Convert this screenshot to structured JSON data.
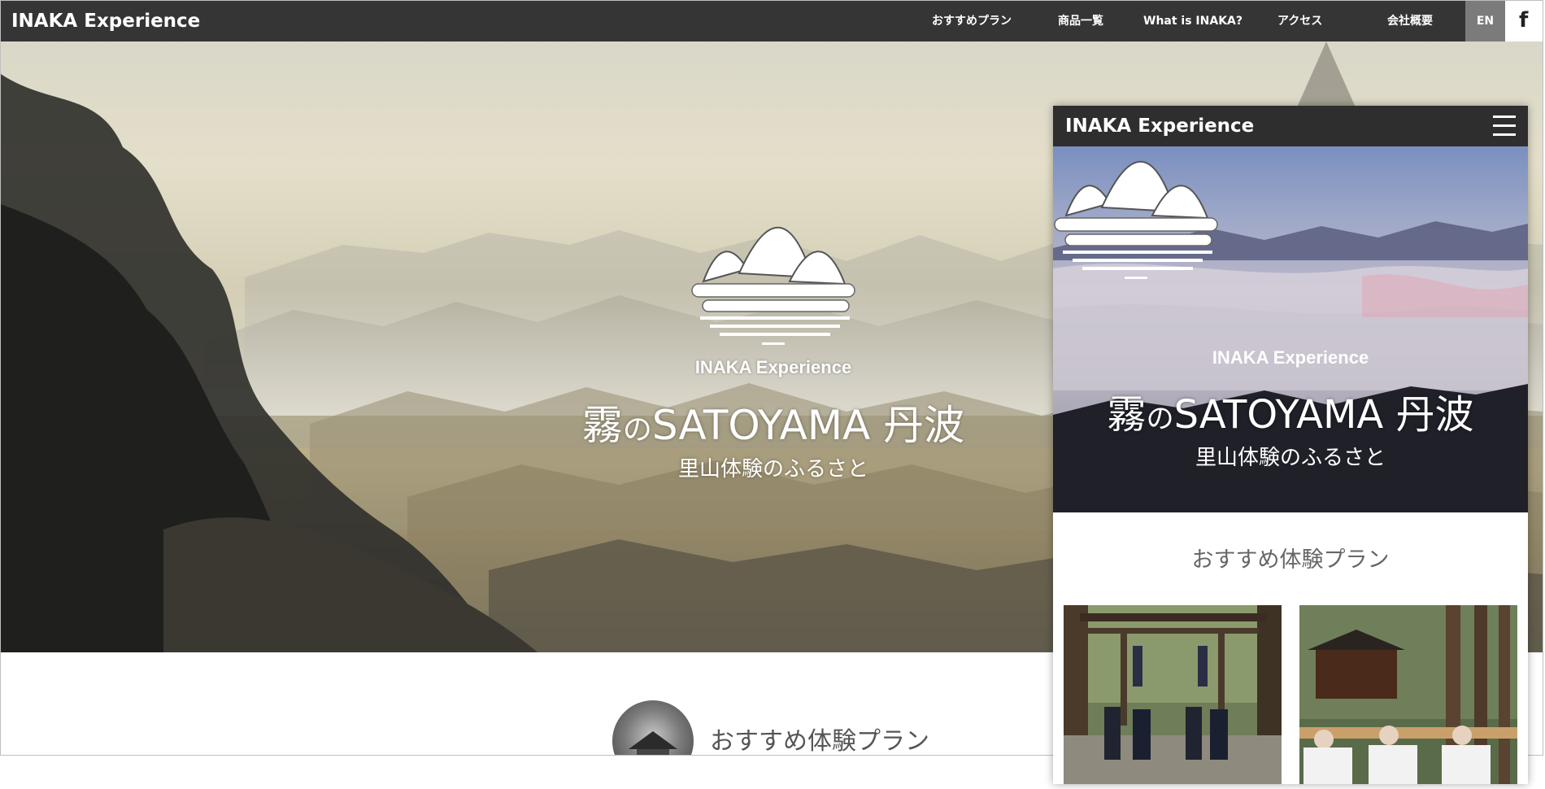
{
  "header": {
    "brand": "INAKA Experience",
    "nav": [
      {
        "label": "おすすめプラン"
      },
      {
        "label": "商品一覧"
      },
      {
        "label": "What is INAKA?"
      },
      {
        "label": "アクセス"
      },
      {
        "label": "会社概要"
      }
    ],
    "lang": "EN",
    "social_icon": "facebook-icon",
    "social_label": "f"
  },
  "hero": {
    "logo_text": "INAKA Experience",
    "title_kanji": "霧",
    "title_no": "の",
    "title_main": "SATOYAMA 丹波",
    "subtitle": "里山体験のふるさと"
  },
  "section": {
    "title": "おすすめ体験プラン"
  },
  "mobile": {
    "brand": "INAKA Experience",
    "menu_icon": "hamburger-menu-icon",
    "logo_text": "INAKA Experience",
    "title_kanji": "霧",
    "title_no": "の",
    "title_main": "SATOYAMA 丹波",
    "subtitle": "里山体験のふるさと",
    "section_title": "おすすめ体験プラン",
    "cards": [
      {
        "name": "shrine-festival-photo"
      },
      {
        "name": "mikoshi-procession-photo"
      }
    ]
  },
  "colors": {
    "header_bg": "#353535",
    "lang_bg": "#7b7b7b",
    "mobile_header_bg": "#2e2e2e"
  }
}
